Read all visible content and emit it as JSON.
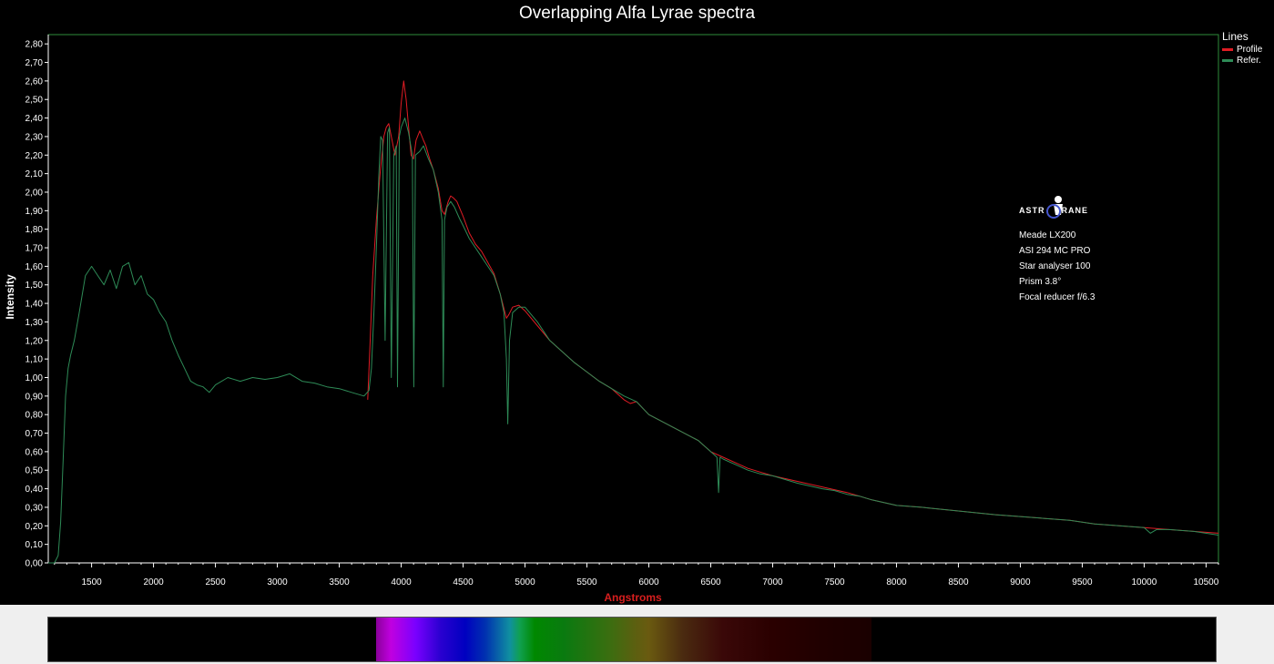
{
  "chart_data": {
    "type": "line",
    "title": "Overlapping Alfa Lyrae spectra",
    "xlabel": "Angstroms",
    "ylabel": "Intensity",
    "xlim": [
      1150,
      10600
    ],
    "ylim": [
      0,
      2.85
    ],
    "x_ticks": [
      1500,
      2000,
      2500,
      3000,
      3500,
      4000,
      4500,
      5000,
      5500,
      6000,
      6500,
      7000,
      7500,
      8000,
      8500,
      9000,
      9500,
      10000,
      10500
    ],
    "y_ticks": [
      "0,00",
      "0,10",
      "0,20",
      "0,30",
      "0,40",
      "0,50",
      "0,60",
      "0,70",
      "0,80",
      "0,90",
      "1,00",
      "1,10",
      "1,20",
      "1,30",
      "1,40",
      "1,50",
      "1,60",
      "1,70",
      "1,80",
      "1,90",
      "2,00",
      "2,10",
      "2,20",
      "2,30",
      "2,40",
      "2,50",
      "2,60",
      "2,70",
      "2,80"
    ],
    "grid": false,
    "legend_title": "Lines",
    "legend_position": "top-right",
    "series": [
      {
        "name": "Profile",
        "color": "#e01c24",
        "x": [
          3730,
          3750,
          3770,
          3800,
          3830,
          3860,
          3880,
          3900,
          3920,
          3950,
          3980,
          4000,
          4020,
          4040,
          4060,
          4080,
          4100,
          4120,
          4150,
          4180,
          4200,
          4230,
          4260,
          4300,
          4330,
          4350,
          4380,
          4400,
          4420,
          4450,
          4500,
          4550,
          4600,
          4650,
          4700,
          4750,
          4800,
          4850,
          4870,
          4900,
          4950,
          5000,
          5100,
          5200,
          5300,
          5400,
          5500,
          5600,
          5700,
          5800,
          5850,
          5900,
          6000,
          6200,
          6400,
          6500,
          6600,
          6700,
          6800,
          6900,
          7000,
          7200,
          7400,
          7600,
          7700,
          7800,
          8000,
          8200,
          8500,
          8800,
          9000,
          9200,
          9400,
          9600,
          9800,
          10000,
          10200,
          10400,
          10600
        ],
        "y": [
          0.88,
          1.2,
          1.55,
          1.85,
          2.1,
          2.3,
          2.35,
          2.37,
          2.3,
          2.2,
          2.3,
          2.48,
          2.6,
          2.5,
          2.35,
          2.2,
          2.18,
          2.28,
          2.33,
          2.28,
          2.25,
          2.18,
          2.12,
          2.02,
          1.9,
          1.88,
          1.95,
          1.98,
          1.97,
          1.95,
          1.87,
          1.78,
          1.72,
          1.68,
          1.62,
          1.56,
          1.45,
          1.32,
          1.34,
          1.38,
          1.39,
          1.36,
          1.28,
          1.2,
          1.14,
          1.08,
          1.03,
          0.98,
          0.94,
          0.88,
          0.86,
          0.87,
          0.8,
          0.73,
          0.66,
          0.6,
          0.57,
          0.54,
          0.51,
          0.49,
          0.47,
          0.44,
          0.41,
          0.38,
          0.36,
          0.34,
          0.31,
          0.3,
          0.28,
          0.26,
          0.25,
          0.24,
          0.23,
          0.21,
          0.2,
          0.19,
          0.18,
          0.17,
          0.16
        ]
      },
      {
        "name": "Refer.",
        "color": "#2e8b57",
        "x": [
          1150,
          1200,
          1230,
          1250,
          1270,
          1290,
          1310,
          1330,
          1360,
          1400,
          1450,
          1500,
          1550,
          1600,
          1650,
          1700,
          1750,
          1800,
          1850,
          1900,
          1950,
          2000,
          2050,
          2100,
          2150,
          2200,
          2250,
          2300,
          2350,
          2400,
          2450,
          2500,
          2600,
          2700,
          2800,
          2900,
          3000,
          3100,
          3200,
          3300,
          3400,
          3500,
          3600,
          3700,
          3740,
          3760,
          3780,
          3800,
          3820,
          3835,
          3850,
          3870,
          3890,
          3905,
          3920,
          3940,
          3960,
          3970,
          3985,
          4000,
          4030,
          4060,
          4090,
          4102,
          4115,
          4150,
          4180,
          4220,
          4260,
          4300,
          4330,
          4340,
          4350,
          4370,
          4400,
          4430,
          4470,
          4500,
          4550,
          4600,
          4650,
          4700,
          4750,
          4800,
          4830,
          4850,
          4861,
          4875,
          4900,
          4950,
          5000,
          5100,
          5200,
          5300,
          5400,
          5500,
          5600,
          5700,
          5800,
          5900,
          6000,
          6200,
          6400,
          6500,
          6550,
          6563,
          6575,
          6600,
          6700,
          6800,
          6900,
          7000,
          7200,
          7400,
          7500,
          7600,
          7700,
          7800,
          8000,
          8200,
          8500,
          8800,
          9000,
          9200,
          9400,
          9600,
          9800,
          10000,
          10050,
          10100,
          10200,
          10400,
          10600
        ],
        "y": [
          0.0,
          0.0,
          0.04,
          0.22,
          0.55,
          0.9,
          1.05,
          1.12,
          1.2,
          1.35,
          1.55,
          1.6,
          1.55,
          1.5,
          1.58,
          1.48,
          1.6,
          1.62,
          1.5,
          1.55,
          1.45,
          1.42,
          1.35,
          1.3,
          1.2,
          1.12,
          1.05,
          0.98,
          0.96,
          0.95,
          0.92,
          0.96,
          1.0,
          0.98,
          1.0,
          0.99,
          1.0,
          1.02,
          0.98,
          0.97,
          0.95,
          0.94,
          0.92,
          0.9,
          0.93,
          1.05,
          1.35,
          1.7,
          2.1,
          2.3,
          2.28,
          1.2,
          2.32,
          2.35,
          1.0,
          2.2,
          2.25,
          0.95,
          2.3,
          2.35,
          2.4,
          2.32,
          2.2,
          0.95,
          2.2,
          2.22,
          2.25,
          2.18,
          2.12,
          2.0,
          1.85,
          0.95,
          1.85,
          1.92,
          1.95,
          1.92,
          1.86,
          1.82,
          1.75,
          1.7,
          1.65,
          1.6,
          1.55,
          1.45,
          1.35,
          1.1,
          0.75,
          1.2,
          1.35,
          1.38,
          1.38,
          1.3,
          1.2,
          1.14,
          1.08,
          1.03,
          0.98,
          0.94,
          0.9,
          0.87,
          0.8,
          0.73,
          0.66,
          0.6,
          0.57,
          0.38,
          0.57,
          0.56,
          0.53,
          0.5,
          0.48,
          0.47,
          0.43,
          0.4,
          0.39,
          0.37,
          0.36,
          0.34,
          0.31,
          0.3,
          0.28,
          0.26,
          0.25,
          0.24,
          0.23,
          0.21,
          0.2,
          0.19,
          0.16,
          0.18,
          0.18,
          0.17,
          0.15
        ]
      }
    ]
  },
  "annotation": {
    "logo_text_left": "ASTR",
    "logo_text_right": "RANE",
    "lines": [
      "Meade LX200",
      "ASI 294 MC PRO",
      "Star analyser 100",
      "Prism  3.8°",
      "Focal reducer  f/6.3"
    ]
  }
}
